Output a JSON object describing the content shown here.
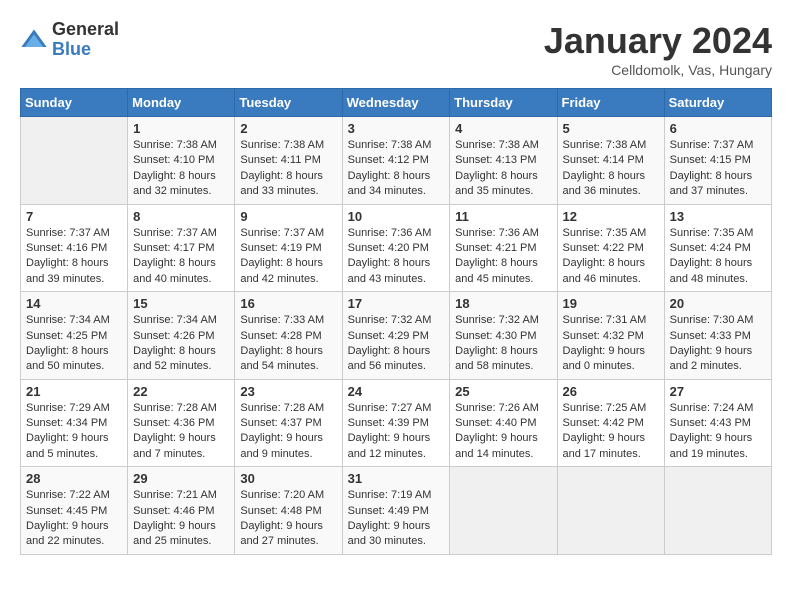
{
  "header": {
    "logo_general": "General",
    "logo_blue": "Blue",
    "month_title": "January 2024",
    "subtitle": "Celldomolk, Vas, Hungary"
  },
  "days_of_week": [
    "Sunday",
    "Monday",
    "Tuesday",
    "Wednesday",
    "Thursday",
    "Friday",
    "Saturday"
  ],
  "weeks": [
    [
      {
        "day": "",
        "info": ""
      },
      {
        "day": "1",
        "info": "Sunrise: 7:38 AM\nSunset: 4:10 PM\nDaylight: 8 hours\nand 32 minutes."
      },
      {
        "day": "2",
        "info": "Sunrise: 7:38 AM\nSunset: 4:11 PM\nDaylight: 8 hours\nand 33 minutes."
      },
      {
        "day": "3",
        "info": "Sunrise: 7:38 AM\nSunset: 4:12 PM\nDaylight: 8 hours\nand 34 minutes."
      },
      {
        "day": "4",
        "info": "Sunrise: 7:38 AM\nSunset: 4:13 PM\nDaylight: 8 hours\nand 35 minutes."
      },
      {
        "day": "5",
        "info": "Sunrise: 7:38 AM\nSunset: 4:14 PM\nDaylight: 8 hours\nand 36 minutes."
      },
      {
        "day": "6",
        "info": "Sunrise: 7:37 AM\nSunset: 4:15 PM\nDaylight: 8 hours\nand 37 minutes."
      }
    ],
    [
      {
        "day": "7",
        "info": "Sunrise: 7:37 AM\nSunset: 4:16 PM\nDaylight: 8 hours\nand 39 minutes."
      },
      {
        "day": "8",
        "info": "Sunrise: 7:37 AM\nSunset: 4:17 PM\nDaylight: 8 hours\nand 40 minutes."
      },
      {
        "day": "9",
        "info": "Sunrise: 7:37 AM\nSunset: 4:19 PM\nDaylight: 8 hours\nand 42 minutes."
      },
      {
        "day": "10",
        "info": "Sunrise: 7:36 AM\nSunset: 4:20 PM\nDaylight: 8 hours\nand 43 minutes."
      },
      {
        "day": "11",
        "info": "Sunrise: 7:36 AM\nSunset: 4:21 PM\nDaylight: 8 hours\nand 45 minutes."
      },
      {
        "day": "12",
        "info": "Sunrise: 7:35 AM\nSunset: 4:22 PM\nDaylight: 8 hours\nand 46 minutes."
      },
      {
        "day": "13",
        "info": "Sunrise: 7:35 AM\nSunset: 4:24 PM\nDaylight: 8 hours\nand 48 minutes."
      }
    ],
    [
      {
        "day": "14",
        "info": "Sunrise: 7:34 AM\nSunset: 4:25 PM\nDaylight: 8 hours\nand 50 minutes."
      },
      {
        "day": "15",
        "info": "Sunrise: 7:34 AM\nSunset: 4:26 PM\nDaylight: 8 hours\nand 52 minutes."
      },
      {
        "day": "16",
        "info": "Sunrise: 7:33 AM\nSunset: 4:28 PM\nDaylight: 8 hours\nand 54 minutes."
      },
      {
        "day": "17",
        "info": "Sunrise: 7:32 AM\nSunset: 4:29 PM\nDaylight: 8 hours\nand 56 minutes."
      },
      {
        "day": "18",
        "info": "Sunrise: 7:32 AM\nSunset: 4:30 PM\nDaylight: 8 hours\nand 58 minutes."
      },
      {
        "day": "19",
        "info": "Sunrise: 7:31 AM\nSunset: 4:32 PM\nDaylight: 9 hours\nand 0 minutes."
      },
      {
        "day": "20",
        "info": "Sunrise: 7:30 AM\nSunset: 4:33 PM\nDaylight: 9 hours\nand 2 minutes."
      }
    ],
    [
      {
        "day": "21",
        "info": "Sunrise: 7:29 AM\nSunset: 4:34 PM\nDaylight: 9 hours\nand 5 minutes."
      },
      {
        "day": "22",
        "info": "Sunrise: 7:28 AM\nSunset: 4:36 PM\nDaylight: 9 hours\nand 7 minutes."
      },
      {
        "day": "23",
        "info": "Sunrise: 7:28 AM\nSunset: 4:37 PM\nDaylight: 9 hours\nand 9 minutes."
      },
      {
        "day": "24",
        "info": "Sunrise: 7:27 AM\nSunset: 4:39 PM\nDaylight: 9 hours\nand 12 minutes."
      },
      {
        "day": "25",
        "info": "Sunrise: 7:26 AM\nSunset: 4:40 PM\nDaylight: 9 hours\nand 14 minutes."
      },
      {
        "day": "26",
        "info": "Sunrise: 7:25 AM\nSunset: 4:42 PM\nDaylight: 9 hours\nand 17 minutes."
      },
      {
        "day": "27",
        "info": "Sunrise: 7:24 AM\nSunset: 4:43 PM\nDaylight: 9 hours\nand 19 minutes."
      }
    ],
    [
      {
        "day": "28",
        "info": "Sunrise: 7:22 AM\nSunset: 4:45 PM\nDaylight: 9 hours\nand 22 minutes."
      },
      {
        "day": "29",
        "info": "Sunrise: 7:21 AM\nSunset: 4:46 PM\nDaylight: 9 hours\nand 25 minutes."
      },
      {
        "day": "30",
        "info": "Sunrise: 7:20 AM\nSunset: 4:48 PM\nDaylight: 9 hours\nand 27 minutes."
      },
      {
        "day": "31",
        "info": "Sunrise: 7:19 AM\nSunset: 4:49 PM\nDaylight: 9 hours\nand 30 minutes."
      },
      {
        "day": "",
        "info": ""
      },
      {
        "day": "",
        "info": ""
      },
      {
        "day": "",
        "info": ""
      }
    ]
  ]
}
